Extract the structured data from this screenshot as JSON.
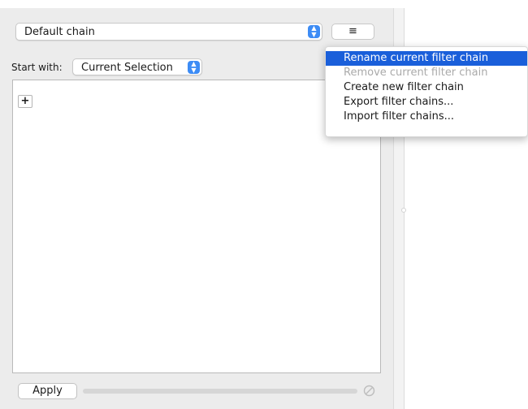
{
  "chain_select": {
    "value": "Default chain",
    "stepper_icon": "up-down-chevron-icon"
  },
  "menu_button": {
    "icon": "hamburger-icon",
    "glyph": "≡"
  },
  "start_with": {
    "label": "Start with:",
    "value": "Current Selection",
    "stepper_icon": "up-down-chevron-icon"
  },
  "filter_area": {
    "add_glyph": "+"
  },
  "footer": {
    "apply_label": "Apply",
    "progress": 0,
    "cancel_icon": "cancel-circle-icon"
  },
  "menu": {
    "items": [
      {
        "label": "Rename current filter chain",
        "state": "selected"
      },
      {
        "label": "Remove current filter chain",
        "state": "disabled"
      },
      {
        "label": "Create new filter chain",
        "state": "normal"
      },
      {
        "label": "Export filter chains...",
        "state": "normal"
      },
      {
        "label": "Import filter chains...",
        "state": "normal"
      }
    ]
  },
  "colors": {
    "selection_blue": "#1a5fda",
    "stepper_blue": "#3d8cf5",
    "panel_gray": "#ececec"
  }
}
